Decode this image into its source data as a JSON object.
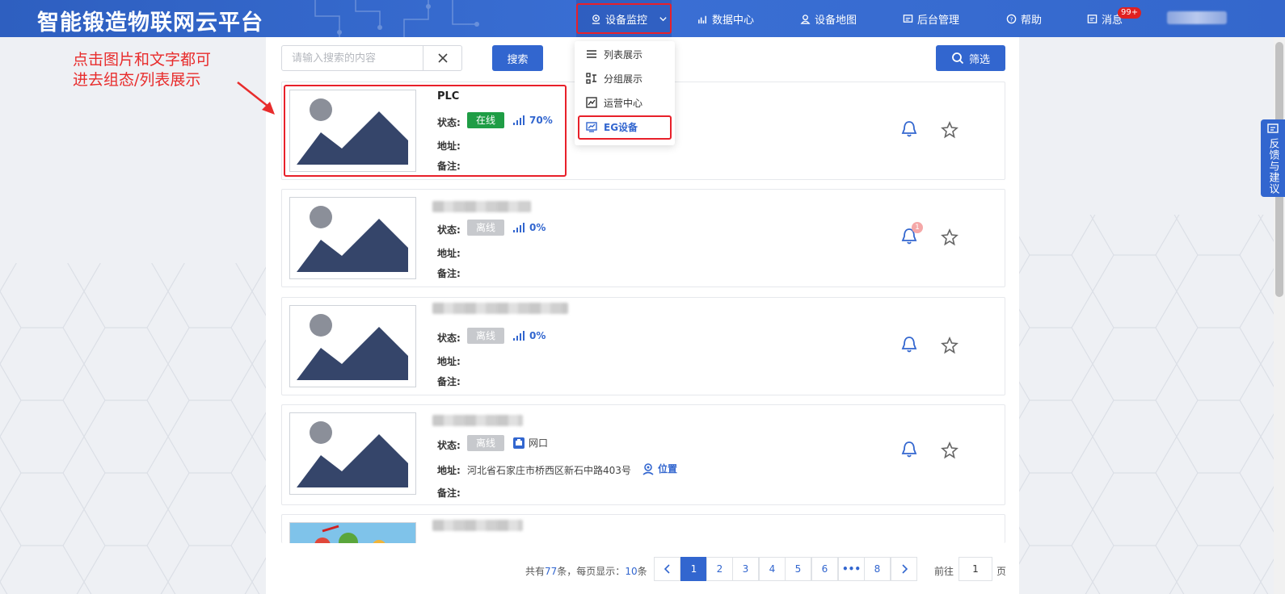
{
  "header": {
    "brand": "智能锻造物联网云平台",
    "nav": [
      {
        "label": "设备监控",
        "icon": "monitor-pin-icon",
        "active": true
      },
      {
        "label": "数据中心",
        "icon": "bar-chart-icon"
      },
      {
        "label": "设备地图",
        "icon": "map-person-icon"
      },
      {
        "label": "后台管理",
        "icon": "admin-panel-icon"
      },
      {
        "label": "帮助",
        "icon": "help-circle-icon"
      },
      {
        "label": "消息",
        "icon": "message-icon"
      }
    ],
    "message_badge": "99+"
  },
  "dropdown": {
    "items": [
      {
        "label": "列表展示",
        "icon": "list-icon"
      },
      {
        "label": "分组展示",
        "icon": "group-icon"
      },
      {
        "label": "运营中心",
        "icon": "operations-chart-icon"
      },
      {
        "label": "EG设备",
        "icon": "eg-device-icon",
        "active": true
      }
    ]
  },
  "search": {
    "placeholder": "请输入搜索的内容",
    "button": "搜索",
    "filter": "筛选"
  },
  "annotation": {
    "line1": "点击图片和文字都可",
    "line2": "进去组态/列表展示"
  },
  "labels": {
    "status": "状态:",
    "address": "地址:",
    "remark": "备注:",
    "location": "位置",
    "online": "在线",
    "offline": "离线"
  },
  "devices": [
    {
      "name": "PLC",
      "status": "在线",
      "signal": "70%",
      "address": "",
      "remark": ""
    },
    {
      "name": "",
      "status": "离线",
      "signal": "0%",
      "address": "",
      "remark": "",
      "alarm_count": "1"
    },
    {
      "name": "",
      "status": "离线",
      "signal": "0%",
      "address": "",
      "remark": ""
    },
    {
      "name": "",
      "status": "离线",
      "network": "网口",
      "address": "河北省石家庄市桥西区新石中路403号",
      "remark": ""
    },
    {
      "name": ""
    }
  ],
  "pagination": {
    "total_prefix": "共有",
    "total": "77",
    "total_suffix": "条，每页显示：",
    "per_page": "10",
    "per_page_suffix": "条",
    "pages": [
      "1",
      "2",
      "3",
      "4",
      "5",
      "6",
      "•••",
      "8"
    ],
    "current": "1",
    "goto_prefix": "前往",
    "goto_value": "1",
    "goto_suffix": "页"
  },
  "feedback": "反馈与建议",
  "colors": {
    "primary": "#3266cf",
    "online": "#1f9d45",
    "offline": "#c7c9cd",
    "annotation": "#e8202a"
  }
}
